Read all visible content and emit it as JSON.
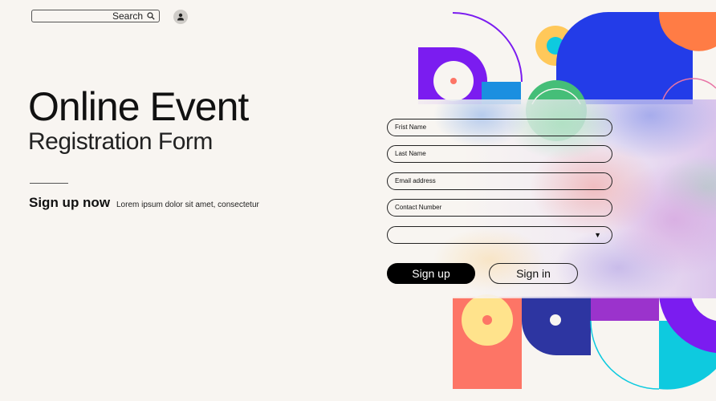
{
  "header": {
    "search_label": "Search",
    "search_icon": "search-icon",
    "avatar_icon": "user-icon"
  },
  "hero": {
    "title": "Online Event",
    "subtitle": "Registration Form",
    "cta_heading": "Sign up now",
    "cta_text": "Lorem ipsum dolor sit amet, consectetur"
  },
  "form": {
    "first_name_placeholder": "Frist Name",
    "last_name_placeholder": "Last Name",
    "email_placeholder": "Email address",
    "contact_placeholder": "Contact Number",
    "select_value": "",
    "select_arrow": "▼",
    "signup_label": "Sign up",
    "signin_label": "Sign in"
  },
  "colors": {
    "background": "#f8f5f1",
    "primary_button": "#000000",
    "purple": "#7b1cf0",
    "blue": "#233ce8",
    "orange": "#ff7c45",
    "yellow": "#ffc85a",
    "cyan": "#0ecadf",
    "green": "#45be78",
    "coral": "#fd7566",
    "navy": "#2d35a1",
    "magenta": "#9b33cc"
  }
}
